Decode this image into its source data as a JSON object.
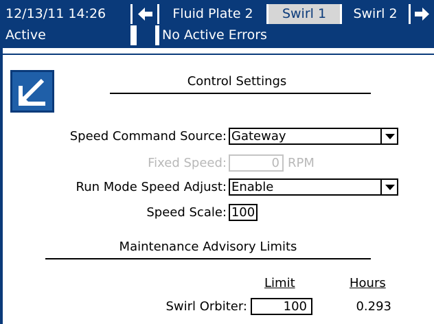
{
  "header": {
    "datetime": "12/13/11 14:26",
    "tabs": [
      "Fluid Plate 2",
      "Swirl 1",
      "Swirl 2"
    ],
    "active_tab": "Swirl 1",
    "status": "Active",
    "errors": "No Active Errors"
  },
  "colors": {
    "header_bg": "#0a3a7a",
    "active_tab_bg": "#d6d6d6",
    "edit_icon_bg": "#1f5fa8"
  },
  "icons": {
    "edit": "edit-icon",
    "prev": "arrow-left-icon",
    "next": "arrow-right-icon"
  },
  "control_settings": {
    "title": "Control Settings",
    "speed_command_source": {
      "label": "Speed Command Source:",
      "value": "Gateway"
    },
    "fixed_speed": {
      "label": "Fixed Speed:",
      "value": "0",
      "unit": "RPM"
    },
    "run_mode_speed_adjust": {
      "label": "Run Mode Speed Adjust:",
      "value": "Enable"
    },
    "speed_scale": {
      "label": "Speed Scale:",
      "value": "100"
    }
  },
  "maintenance": {
    "title": "Maintenance Advisory Limits",
    "col_limit": "Limit",
    "col_hours": "Hours",
    "swirl_orbiter": {
      "label": "Swirl Orbiter:",
      "limit": "100",
      "hours": "0.293"
    }
  }
}
